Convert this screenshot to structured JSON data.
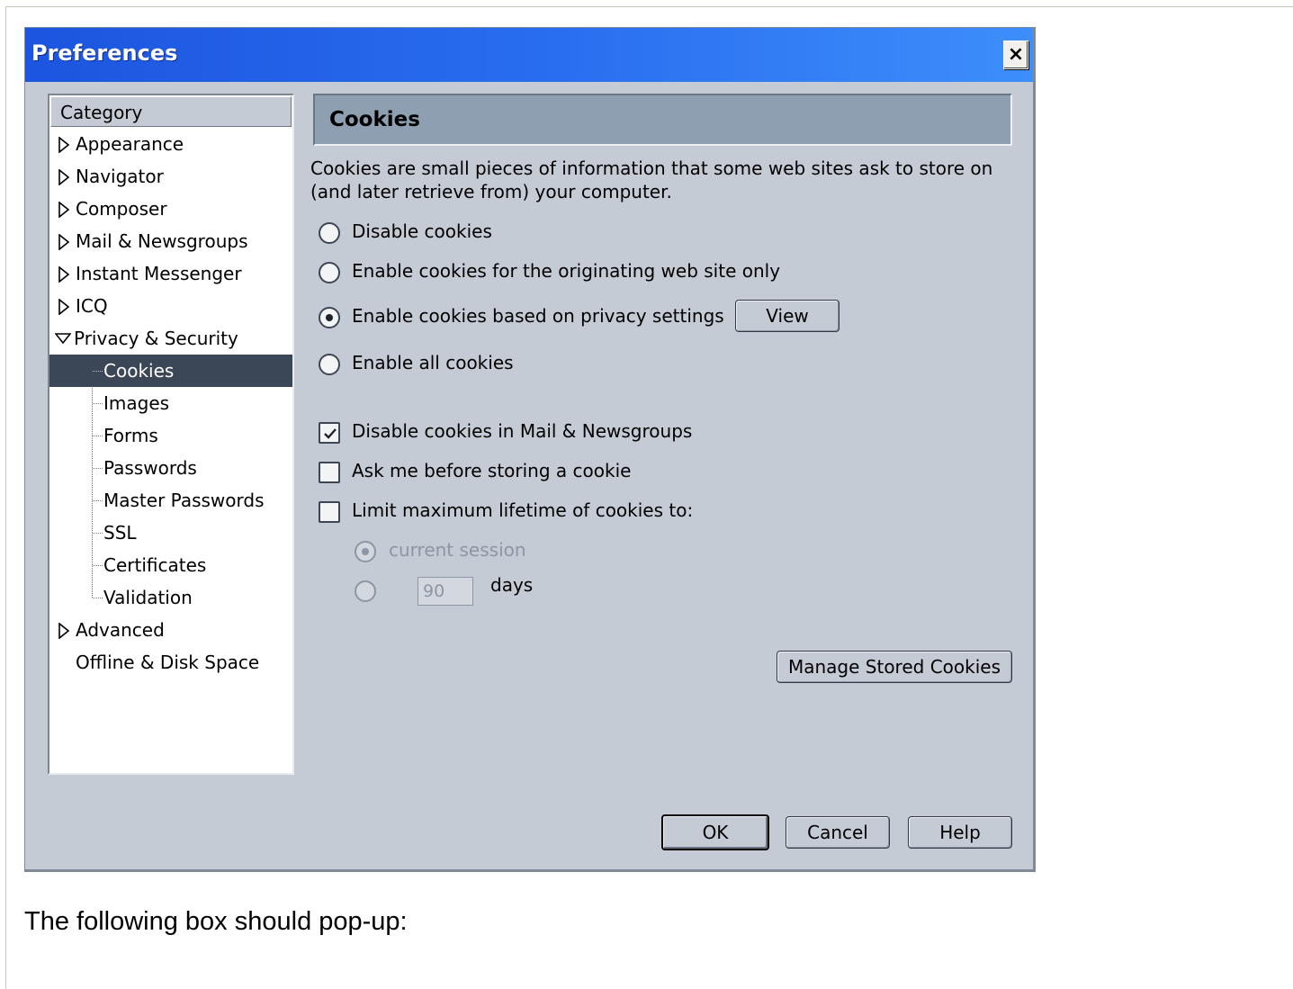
{
  "dialog": {
    "title": "Preferences",
    "close_label": "×"
  },
  "category": {
    "header": "Category",
    "items": [
      {
        "label": "Appearance"
      },
      {
        "label": "Navigator"
      },
      {
        "label": "Composer"
      },
      {
        "label": "Mail & Newsgroups"
      },
      {
        "label": "Instant Messenger"
      },
      {
        "label": "ICQ"
      },
      {
        "label": "Privacy & Security"
      },
      {
        "label": "Cookies"
      },
      {
        "label": "Images"
      },
      {
        "label": "Forms"
      },
      {
        "label": "Passwords"
      },
      {
        "label": "Master Passwords"
      },
      {
        "label": "SSL"
      },
      {
        "label": "Certificates"
      },
      {
        "label": "Validation"
      },
      {
        "label": "Advanced"
      },
      {
        "label": "Offline & Disk Space"
      }
    ],
    "selected": "Cookies"
  },
  "panel": {
    "title": "Cookies",
    "description": "Cookies are small pieces of information that some web sites ask to store on (and later retrieve from) your computer.",
    "radios": [
      {
        "label": "Disable cookies",
        "checked": false
      },
      {
        "label": "Enable cookies for the originating web site only",
        "checked": false
      },
      {
        "label": "Enable cookies based on privacy settings",
        "checked": true
      },
      {
        "label": "Enable all cookies",
        "checked": false
      }
    ],
    "view_button_label": "View",
    "checkboxes": [
      {
        "label": "Disable cookies in Mail & Newsgroups",
        "checked": true
      },
      {
        "label": "Ask me before storing a cookie",
        "checked": false
      },
      {
        "label": "Limit maximum lifetime of cookies to:",
        "checked": false
      }
    ],
    "lifetime": {
      "session_label": "current session",
      "days_value": "90",
      "days_label": "days"
    },
    "manage_button_label": "Manage Stored Cookies"
  },
  "footer": {
    "ok_label": "OK",
    "cancel_label": "Cancel",
    "help_label": "Help"
  },
  "caption": "The following box should pop-up:"
}
